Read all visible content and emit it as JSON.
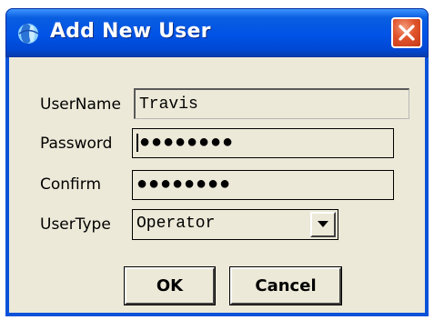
{
  "window": {
    "title": "Add New User",
    "icon": "app-globe-icon",
    "close_icon": "close-icon"
  },
  "form": {
    "username_label": "UserName",
    "username_value": "Travis",
    "password_label": "Password",
    "password_value": "●●●●●●●●",
    "confirm_label": "Confirm",
    "confirm_value": "●●●●●●●●",
    "usertype_label": "UserType",
    "usertype_value": "Operator",
    "usertype_dropdown_icon": "chevron-down-icon"
  },
  "buttons": {
    "ok_label": "OK",
    "cancel_label": "Cancel"
  },
  "colors": {
    "titlebar": "#0053e6",
    "window_bg": "#ece9d8",
    "close_button": "#e0542c"
  }
}
